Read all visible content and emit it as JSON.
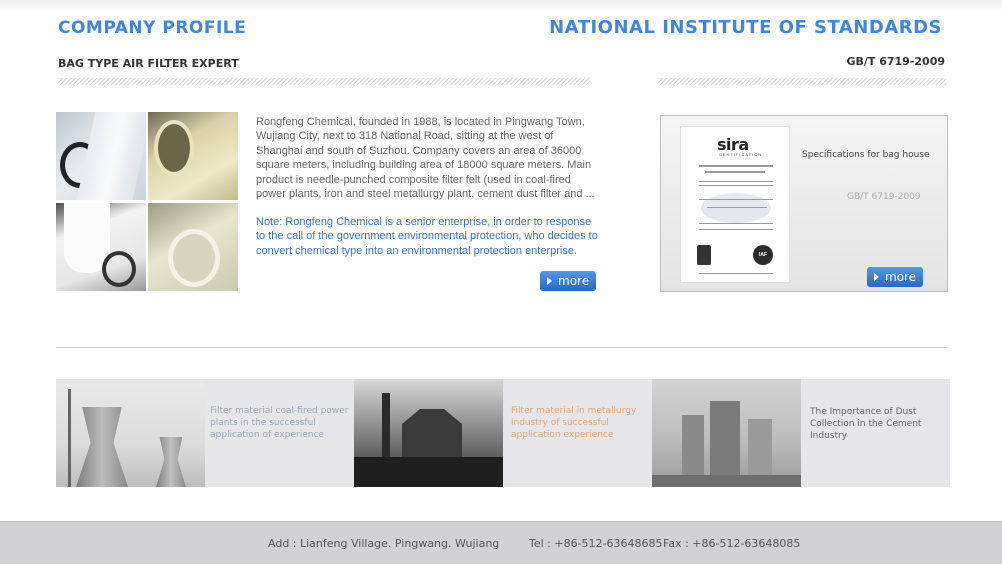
{
  "header": {
    "left_title": "COMPANY PROFILE",
    "left_subtitle": "BAG TYPE AIR FILTER EXPERT",
    "right_title": "NATIONAL INSTITUTE OF STANDARDS",
    "right_subtitle": "GB/T 6719-2009"
  },
  "company": {
    "intro": "Rongfeng Chemical, founded in 1988, is located in Pingwang Town, Wujiang City, next to 318 National Road, sitting at the west of Shanghai and south of Suzhou. Company covers an area of 36000 square meters, including building area of 18000 square meters. Main product is needle-punched composite filter felt (used in coal-fired power plants, iron and steel metallurgy plant, cement dust filter and ...",
    "note": "Note: Rongfeng Chemical is a senior enterprise, in order to response to the call of the government environmental protection, who decides to convert chemical type into an environmental protection enterprise.",
    "more_label": "more"
  },
  "standards": {
    "cert_logo": "sira",
    "cert_logo_sub": "CERTIFICATION",
    "description": "Specifications for bag house",
    "code": "GB/T 6719-2009",
    "more_label": "more",
    "iaf_label": "IAF"
  },
  "applications": [
    {
      "text": "Filter material coal-fired power plants in the successful application of experience"
    },
    {
      "text": "Filter material in metallurgy industry of successful application experience"
    },
    {
      "text": "The Importance of Dust Collection in the Cement Industry"
    }
  ],
  "footer": {
    "address": "Add :   Lianfeng Village. Pingwang. Wujiang",
    "tel": "Tel : +86-512-63648685",
    "fax": "Fax : +86-512-63648085"
  },
  "colors": {
    "accent_blue": "#3f86dd",
    "note_blue": "#3a72c6",
    "metallurgy_orange": "#e0a77b"
  }
}
